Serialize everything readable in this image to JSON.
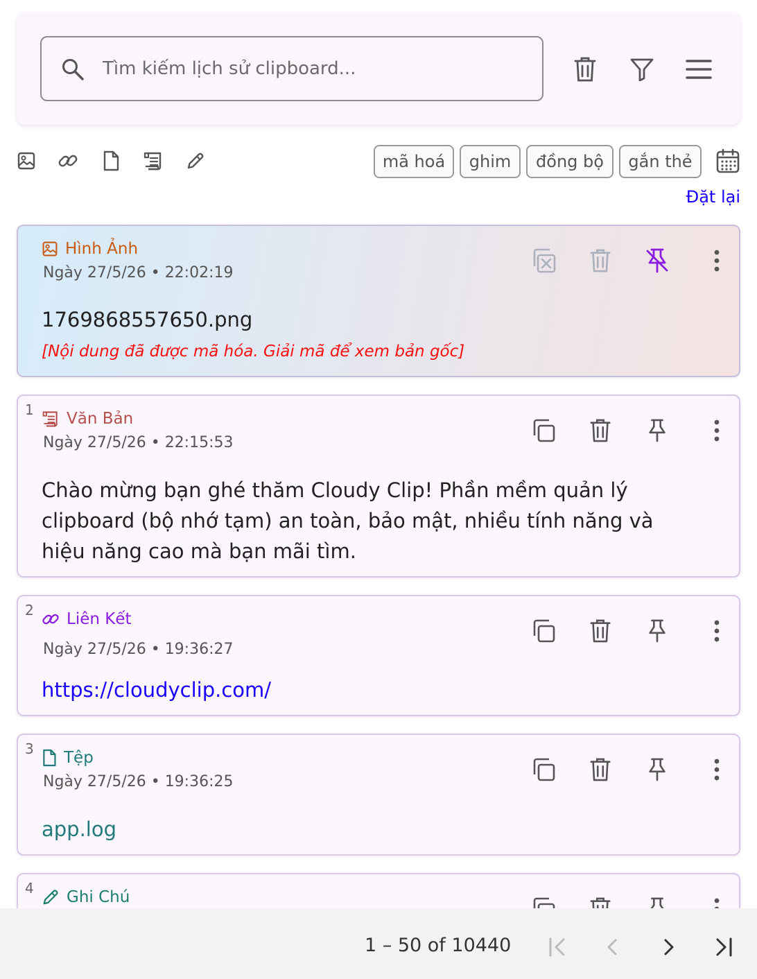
{
  "search": {
    "placeholder": "Tìm kiếm lịch sử clipboard..."
  },
  "toolbar": {
    "icons": [
      "trash-icon",
      "filter-icon",
      "menu-icon"
    ]
  },
  "type_filters": [
    "image-icon",
    "link-icon",
    "file-icon",
    "text-icon",
    "note-icon"
  ],
  "chips": [
    "mã hoá",
    "ghim",
    "đồng bộ",
    "gắn thẻ"
  ],
  "reset_label": "Đặt lại",
  "colors": {
    "image": "#c95a13",
    "text": "#b6504d",
    "link": "#8a1ee0",
    "file": "#237a7a",
    "note": "#1d7f70",
    "unpin": "#8a1ee0",
    "link_text": "#1a00ff",
    "encrypted": "#ff1010"
  },
  "items": [
    {
      "index": "",
      "type": "Hình Ảnh",
      "date": "Ngày 27/5/26 • 22:02:19",
      "content": "1769868557650.png",
      "note": "[Nội dung đã được mã hóa. Giải mã để xem bản gốc]"
    },
    {
      "index": "1",
      "type": "Văn Bản",
      "date": "Ngày 27/5/26 • 22:15:53",
      "content": "Chào mừng bạn ghé thăm Cloudy Clip! Phần mềm quản lý clipboard (bộ nhớ tạm) an toàn, bảo mật, nhiều tính năng và hiệu năng cao mà bạn mãi tìm."
    },
    {
      "index": "2",
      "type": "Liên Kết",
      "date": "Ngày 27/5/26 • 19:36:27",
      "content": "https://cloudyclip.com/"
    },
    {
      "index": "3",
      "type": "Tệp",
      "date": "Ngày 27/5/26 • 19:36:25",
      "content": "app.log"
    },
    {
      "index": "4",
      "type": "Ghi Chú"
    }
  ],
  "pagination": {
    "range": "1 – 50 of 10440"
  }
}
